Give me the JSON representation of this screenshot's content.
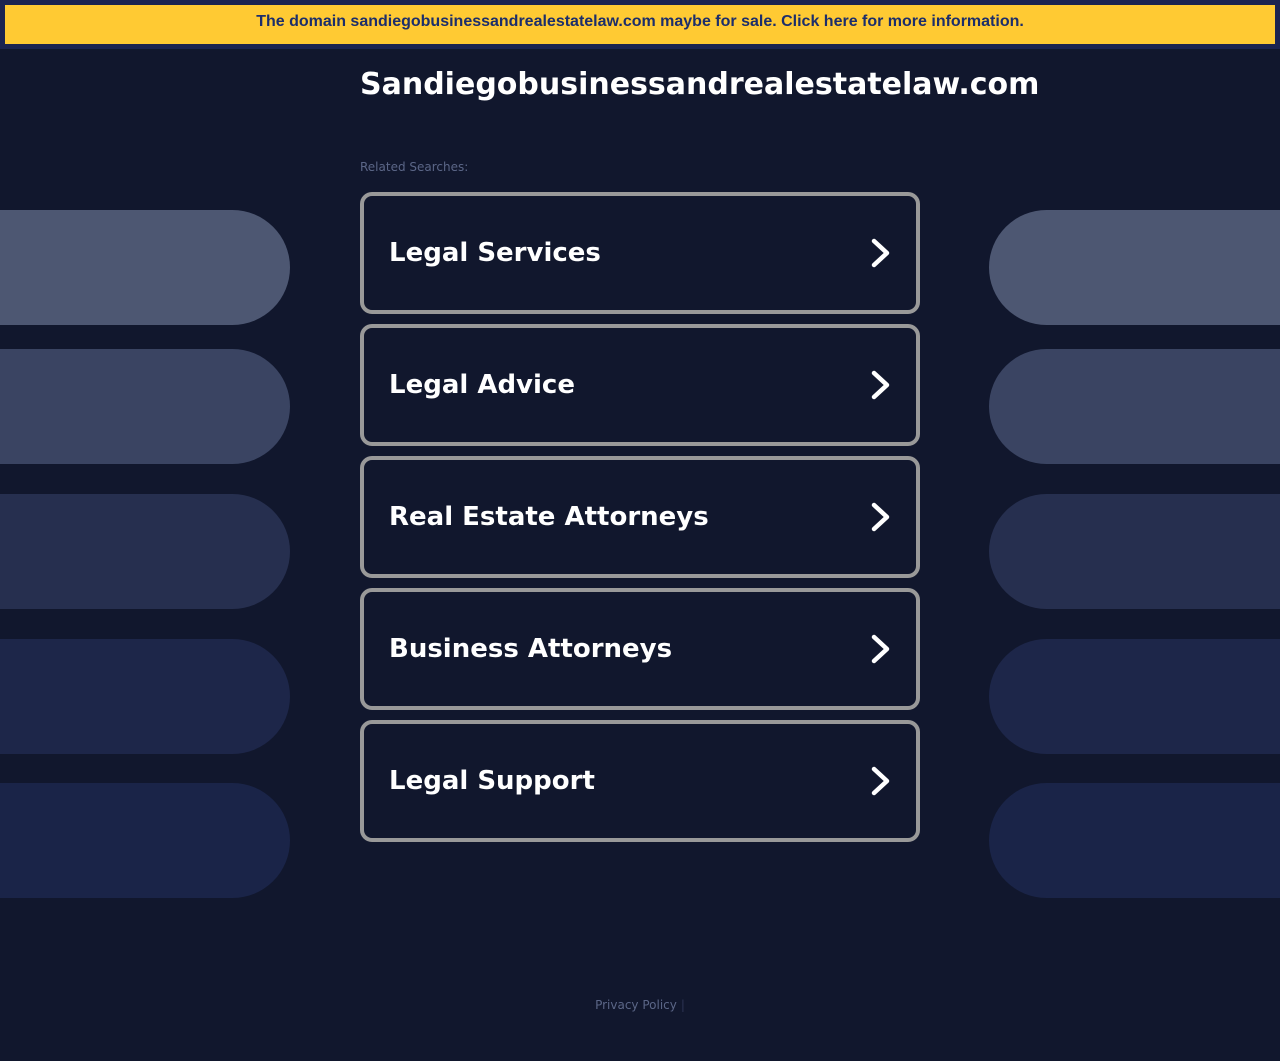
{
  "banner": {
    "text": "The domain sandiegobusinessandrealestatelaw.com maybe for sale. Click here for more information."
  },
  "header": {
    "domain": "Sandiegobusinessandrealestatelaw.com"
  },
  "related": {
    "label": "Related Searches:",
    "items": [
      {
        "label": "Legal Services"
      },
      {
        "label": "Legal Advice"
      },
      {
        "label": "Real Estate Attorneys"
      },
      {
        "label": "Business Attorneys"
      },
      {
        "label": "Legal Support"
      }
    ]
  },
  "footer": {
    "privacy_label": "Privacy Policy",
    "separator": "|"
  },
  "colors": {
    "background": "#11172d",
    "banner_bg": "#ffca33",
    "banner_text": "#1c2e6b",
    "card_border": "#999999",
    "pill_1": "#4d5772",
    "pill_2": "#3a4462",
    "pill_3": "#262f4f",
    "pill_4": "#1d2649",
    "pill_5": "#1a2448"
  },
  "icons": {
    "card_arrow": "chevron-right-icon"
  }
}
